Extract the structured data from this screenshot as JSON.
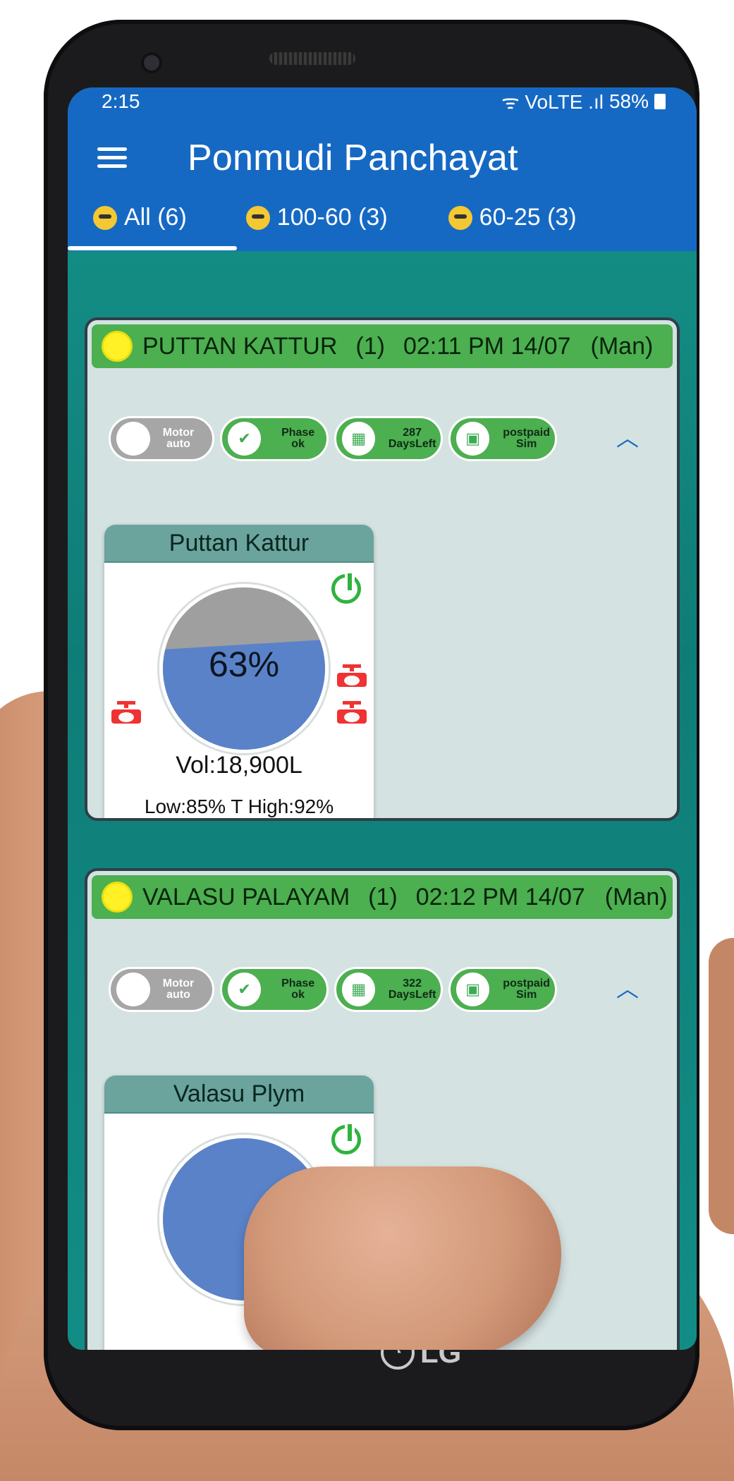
{
  "status": {
    "time": "2:15",
    "signal_icons": "ᯤ VoLTE .ıl",
    "battery": "58%"
  },
  "app": {
    "title": "Ponmudi Panchayat"
  },
  "tabs": [
    {
      "label": "All (6)",
      "icon": "sunglasses-emoji-icon"
    },
    {
      "label": "100-60 (3)",
      "icon": "grin-emoji-icon"
    },
    {
      "label": "60-25 (3)",
      "icon": "smile-emoji-icon"
    }
  ],
  "cards": [
    {
      "site": "PUTTAN KATTUR",
      "count": "(1)",
      "time": "02:11 PM 14/07",
      "mode": "(Man)",
      "chips": {
        "motor_line1": "Motor",
        "motor_line2": "auto",
        "phase_line1": "Phase",
        "phase_line2": "ok",
        "days_line1": "287",
        "days_line2": "DaysLeft",
        "sim_line1": "postpaid",
        "sim_line2": "Sim"
      },
      "tank": {
        "name": "Puttan Kattur",
        "percent_label": "63%",
        "fill_fraction": 0.63,
        "volume": "Vol:18,900L",
        "levels": "Low:85%  T  High:92%"
      }
    },
    {
      "site": "VALASU PALAYAM",
      "count": "(1)",
      "time": "02:12 PM 14/07",
      "mode": "(Man)",
      "chips": {
        "motor_line1": "Motor",
        "motor_line2": "auto",
        "phase_line1": "Phase",
        "phase_line2": "ok",
        "days_line1": "322",
        "days_line2": "DaysLeft",
        "sim_line1": "postpaid",
        "sim_line2": "Sim"
      },
      "tank": {
        "name": "Valasu Plym"
      }
    }
  ],
  "device": {
    "brand": "LG"
  },
  "colors": {
    "appbar": "#1669c3",
    "site_header": "#4caf50",
    "background": "#128d86",
    "tank_fill": "#5a82c8",
    "tank_empty": "#9f9f9f"
  }
}
